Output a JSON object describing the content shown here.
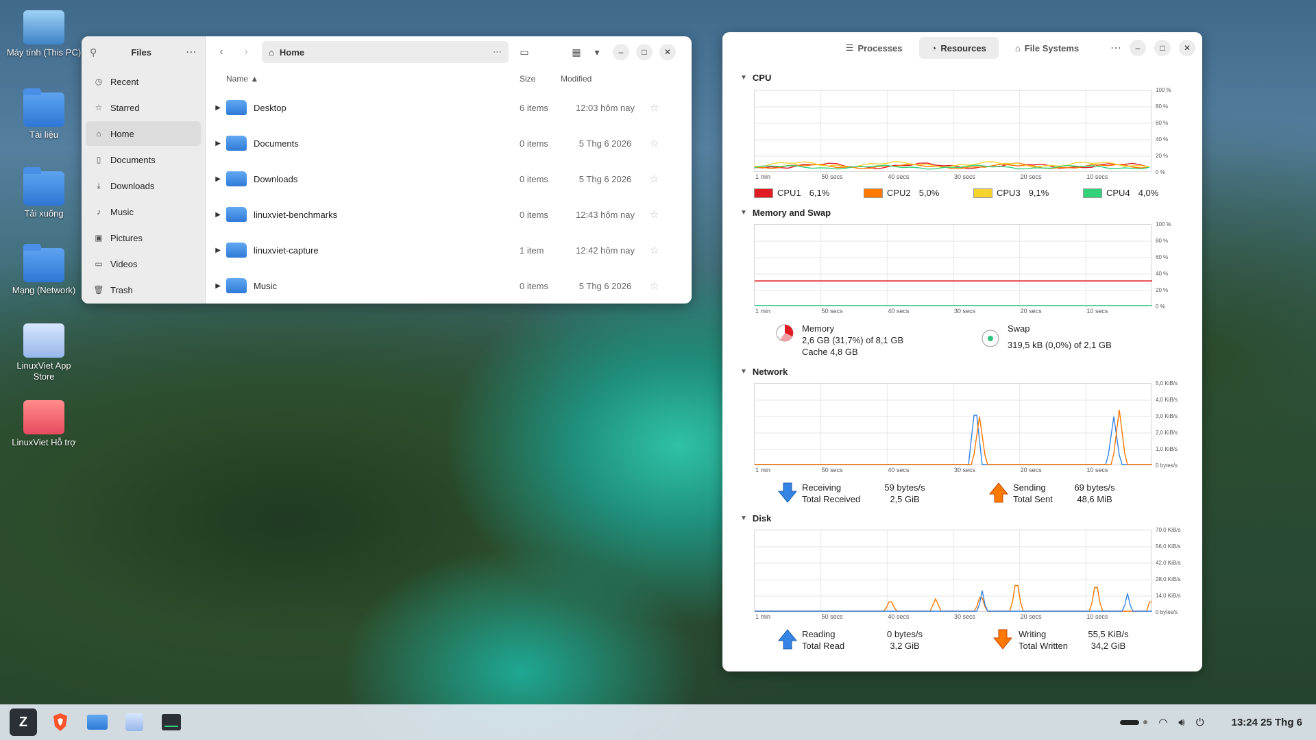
{
  "desktop": {
    "icons": [
      {
        "label": "Máy tính (This PC)"
      },
      {
        "label": "Tài liệu"
      },
      {
        "label": "Tải xuống"
      },
      {
        "label": "Mạng (Network)"
      },
      {
        "label": "LinuxViet App Store"
      },
      {
        "label": "LinuxViet Hỗ trợ"
      }
    ]
  },
  "files": {
    "sidebar_title": "Files",
    "sidebar": [
      {
        "label": "Recent",
        "icon": "clock-icon"
      },
      {
        "label": "Starred",
        "icon": "star-icon"
      },
      {
        "label": "Home",
        "icon": "home-icon"
      },
      {
        "label": "Documents",
        "icon": "document-icon"
      },
      {
        "label": "Downloads",
        "icon": "download-icon"
      },
      {
        "label": "Music",
        "icon": "music-icon"
      },
      {
        "label": "Pictures",
        "icon": "picture-icon"
      },
      {
        "label": "Videos",
        "icon": "video-icon"
      },
      {
        "label": "Trash",
        "icon": "trash-icon"
      }
    ],
    "path": "Home",
    "columns": {
      "name": "Name",
      "size": "Size",
      "modified": "Modified"
    },
    "rows": [
      {
        "name": "Desktop",
        "size": "6 items",
        "modified": "12:03 hôm nay"
      },
      {
        "name": "Documents",
        "size": "0 items",
        "modified": "5 Thg 6 2026"
      },
      {
        "name": "Downloads",
        "size": "0 items",
        "modified": "5 Thg 6 2026"
      },
      {
        "name": "linuxviet-benchmarks",
        "size": "0 items",
        "modified": "12:43 hôm nay"
      },
      {
        "name": "linuxviet-capture",
        "size": "1 item",
        "modified": "12:42 hôm nay"
      },
      {
        "name": "Music",
        "size": "0 items",
        "modified": "5 Thg 6 2026"
      }
    ]
  },
  "monitor": {
    "tabs": [
      "Processes",
      "Resources",
      "File Systems"
    ],
    "x_labels": [
      "1 min",
      "50 secs",
      "40 secs",
      "30 secs",
      "20 secs",
      "10 secs"
    ],
    "cpu": {
      "title": "CPU",
      "y_labels": [
        "100 %",
        "80 %",
        "60 %",
        "40 %",
        "20 %",
        "0 %"
      ],
      "legend": [
        {
          "name": "CPU1",
          "value": "6,1%",
          "color": "#e01b24"
        },
        {
          "name": "CPU2",
          "value": "5,0%",
          "color": "#ff7800"
        },
        {
          "name": "CPU3",
          "value": "9,1%",
          "color": "#f6d32d"
        },
        {
          "name": "CPU4",
          "value": "4,0%",
          "color": "#33d17a"
        }
      ]
    },
    "memory": {
      "title": "Memory and Swap",
      "y_labels": [
        "100 %",
        "80 %",
        "60 %",
        "40 %",
        "20 %",
        "0 %"
      ],
      "mem_label": "Memory",
      "mem_value": "2,6 GB (31,7%) of 8,1 GB",
      "cache": "Cache 4,8 GB",
      "swap_label": "Swap",
      "swap_value": "319,5 kB (0,0%) of 2,1 GB"
    },
    "network": {
      "title": "Network",
      "y_labels": [
        "5,0 KiB/s",
        "4,0 KiB/s",
        "3,0 KiB/s",
        "2,0 KiB/s",
        "1,0 KiB/s",
        "0 bytes/s"
      ],
      "receiving_label": "Receiving",
      "receiving_value": "59 bytes/s",
      "total_received_label": "Total Received",
      "total_received_value": "2,5 GiB",
      "sending_label": "Sending",
      "sending_value": "69 bytes/s",
      "total_sent_label": "Total Sent",
      "total_sent_value": "48,6 MiB"
    },
    "disk": {
      "title": "Disk",
      "y_labels": [
        "70,0 KiB/s",
        "56,0 KiB/s",
        "42,0 KiB/s",
        "28,0 KiB/s",
        "14,0 KiB/s",
        "0 bytes/s"
      ],
      "reading_label": "Reading",
      "reading_value": "0 bytes/s",
      "total_read_label": "Total Read",
      "total_read_value": "3,2 GiB",
      "writing_label": "Writing",
      "writing_value": "55,5 KiB/s",
      "total_written_label": "Total Written",
      "total_written_value": "34,2 GiB"
    }
  },
  "taskbar": {
    "clock": "13:24  25 Thg 6"
  }
}
